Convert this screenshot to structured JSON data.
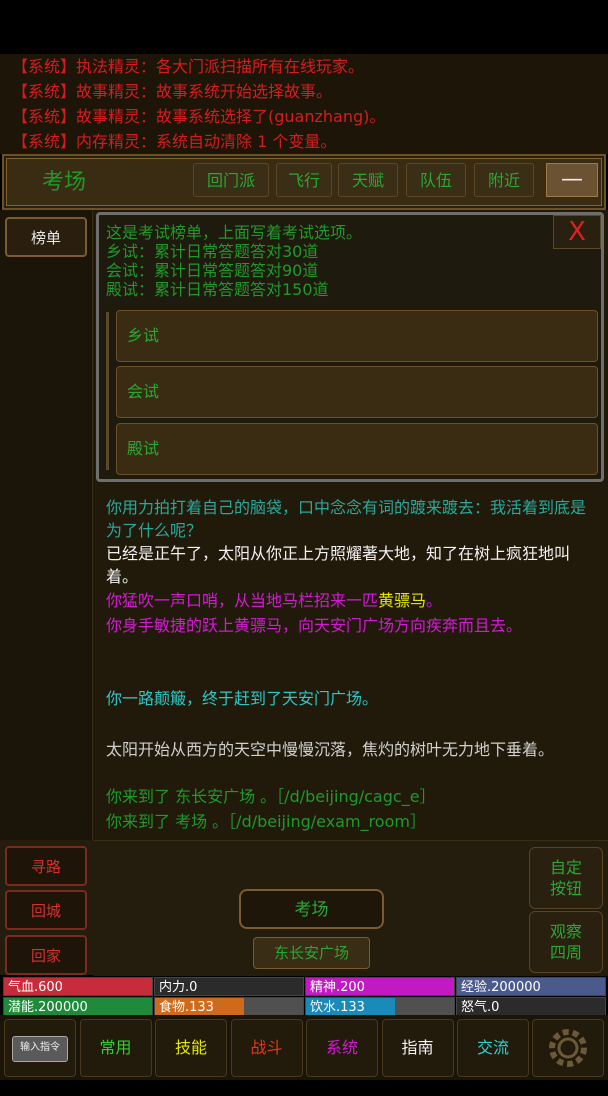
{
  "system_log": [
    "【系统】执法精灵：各大门派扫描所有在线玩家。",
    "【系统】故事精灵：故事系统开始选择故事。",
    "【系统】故事精灵：故事系统选择了(guanzhang)。",
    "【系统】内存精灵：系统自动清除 1 个变量。"
  ],
  "location_title": "考场",
  "nav_buttons": [
    "回门派",
    "飞行",
    "天赋",
    "队伍",
    "附近"
  ],
  "minimize_label": "—",
  "side_buttons": {
    "rank": "榜单",
    "path": "寻路",
    "city": "回城",
    "home": "回家"
  },
  "modal": {
    "lines": [
      "这是考试榜单，上面写着考试选项。",
      "乡试：累计日常答题答对30道",
      "会试：累计日常答题答对90道",
      "殿试：累计日常答题答对150道"
    ],
    "close": "X",
    "options": [
      "乡试",
      "会试",
      "殿试"
    ]
  },
  "story": [
    {
      "text": "你用力拍打着自己的脑袋，口中念念有词的踱来踱去：我活着到底是为了什么呢？",
      "color": "#2aa89a"
    },
    {
      "text": "已经是正午了，太阳从你正上方照耀著大地，知了在树上疯狂地叫着。",
      "color": "#f2f2f2"
    },
    {
      "text": "你猛吹一声口哨，从当地马栏招来一匹",
      "color": "#d21ad2",
      "highlight": "黄骠马",
      "hl_color": "#e6e600",
      "tail": "。"
    },
    {
      "text": "你身手敏捷的跃上黄骠马，向天安门广场方向疾奔而且去。",
      "color": "#d21ad2"
    },
    {
      "text": "你一路颠簸，终于赶到了天安门广场。",
      "color": "#2fc6c6"
    },
    {
      "text": "太阳开始从西方的天空中慢慢沉落，焦灼的树叶无力地下垂着。",
      "color": "#cfcfcf"
    },
    {
      "text": "你来到了 东长安广场 。［/d/beijing/cagc_e］",
      "color": "#1f9a2a"
    },
    {
      "text": "你来到了 考场 。［/d/beijing/exam_room］",
      "color": "#1f9a2a"
    }
  ],
  "right_buttons": {
    "custom": "自定\n按钮",
    "observe": "观察\n四周"
  },
  "current_location": "考场",
  "exit_location": "东长安广场",
  "stats": [
    {
      "label": "气血.600",
      "fraction": 1.0,
      "color": "#c62c3a"
    },
    {
      "label": "内力.0",
      "fraction": 0.0,
      "color": "#3a3a3a"
    },
    {
      "label": "精神.200",
      "fraction": 1.0,
      "color": "#c21ac2"
    },
    {
      "label": "经验.200000",
      "fraction": 1.0,
      "color": "#4a5a8a"
    },
    {
      "label": "潜能.200000",
      "fraction": 1.0,
      "color": "#1f8a3a"
    },
    {
      "label": "食物.133",
      "fraction": 0.6,
      "color": "#d06a1a"
    },
    {
      "label": "饮水.133",
      "fraction": 0.6,
      "color": "#1a8ab8"
    },
    {
      "label": "怒气.0",
      "fraction": 0.0,
      "color": "#3a3a3a"
    }
  ],
  "bottom_tabs": [
    {
      "label": "输入指令",
      "color": "#cfcfcf"
    },
    {
      "label": "常用",
      "color": "#2fd12f"
    },
    {
      "label": "技能",
      "color": "#e6e600"
    },
    {
      "label": "战斗",
      "color": "#e03a1a"
    },
    {
      "label": "系统",
      "color": "#d21ad2"
    },
    {
      "label": "指南",
      "color": "#f2f2f2"
    },
    {
      "label": "交流",
      "color": "#2fd1d1"
    }
  ]
}
